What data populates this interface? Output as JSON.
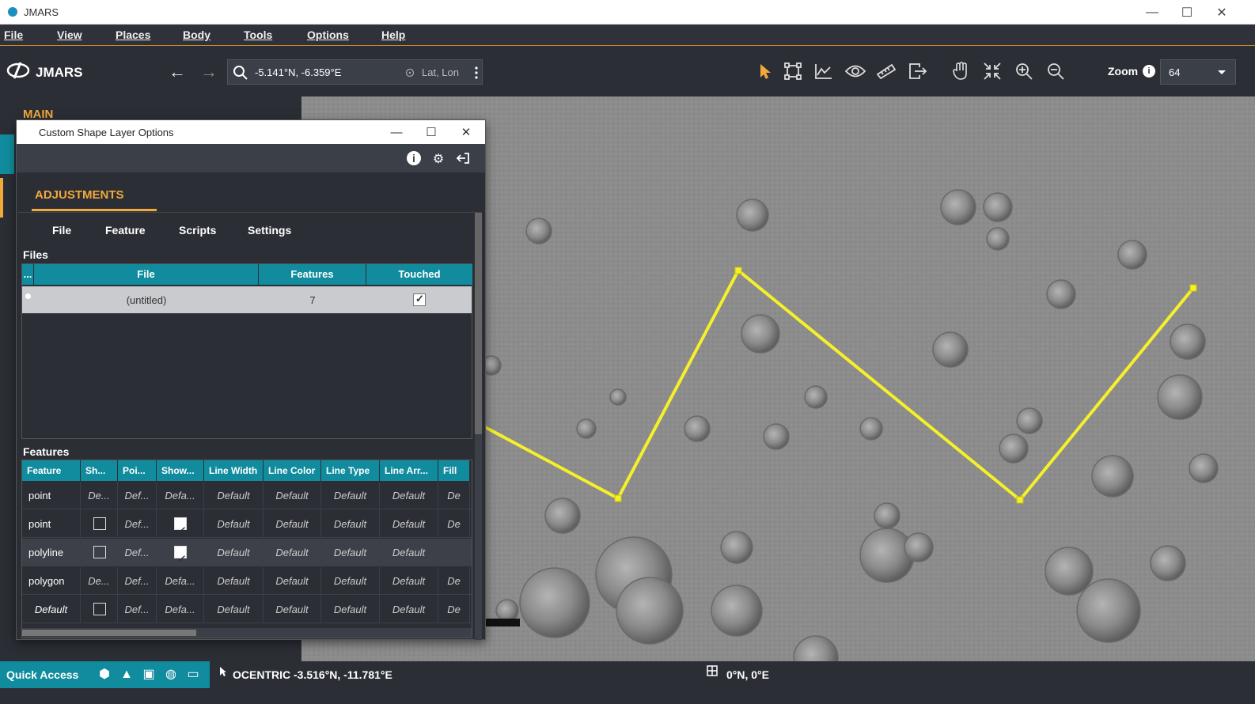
{
  "window": {
    "title": "JMARS",
    "minimize": "—",
    "maximize": "☐",
    "close": "✕"
  },
  "menu": [
    "File",
    "View",
    "Places",
    "Body",
    "Tools",
    "Options",
    "Help"
  ],
  "toolbar": {
    "logo_text": "JMARS",
    "back": "←",
    "forward": "→",
    "search_value": "-5.141°N, -6.359°E",
    "search_mode": "Lat, Lon",
    "zoom_label": "Zoom",
    "zoom_value": "64",
    "tools": [
      "select-icon",
      "bounding-box-icon",
      "chart-icon",
      "eye-icon",
      "ruler-icon",
      "export-icon",
      "hand-icon",
      "compress-icon",
      "zoom-in-icon",
      "zoom-out-icon"
    ]
  },
  "left_panel": {
    "main_tab": "MAIN"
  },
  "dialog": {
    "title": "Custom Shape Layer Options",
    "adjustments_tab": "ADJUSTMENTS",
    "subtabs": [
      "File",
      "Feature",
      "Scripts",
      "Settings"
    ],
    "files_label": "Files",
    "files_columns": [
      "...",
      "File",
      "Features",
      "Touched"
    ],
    "files_rows": [
      {
        "file": "(untitled)",
        "features": "7",
        "touched": true
      }
    ],
    "features_label": "Features",
    "features_columns": [
      "Feature",
      "Sh...",
      "Poi...",
      "Show...",
      "Line Width",
      "Line Color",
      "Line Type",
      "Line Arr...",
      "Fill"
    ],
    "features_rows": [
      {
        "feature": "point",
        "sh": "De...",
        "poi": "Def...",
        "show": "Defa...",
        "lw": "Default",
        "lc": "Default",
        "lt": "Default",
        "la": "Default",
        "fill": "De",
        "sh_check": null,
        "show_check": null
      },
      {
        "feature": "point",
        "sh": "",
        "poi": "Def...",
        "show": "",
        "lw": "Default",
        "lc": "Default",
        "lt": "Default",
        "la": "Default",
        "fill": "De",
        "sh_check": false,
        "show_check": true
      },
      {
        "feature": "polyline",
        "sh": "",
        "poi": "Def...",
        "show": "",
        "lw": "Default",
        "lc": "Default",
        "lt": "Default",
        "la": "Default",
        "fill": "",
        "sh_check": false,
        "show_check": true
      },
      {
        "feature": "polygon",
        "sh": "De...",
        "poi": "Def...",
        "show": "Defa...",
        "lw": "Default",
        "lc": "Default",
        "lt": "Default",
        "la": "Default",
        "fill": "De",
        "sh_check": null,
        "show_check": null
      },
      {
        "feature": "Default",
        "sh": "",
        "poi": "Def...",
        "show": "Defa...",
        "lw": "Default",
        "lc": "Default",
        "lt": "Default",
        "la": "Default",
        "fill": "De",
        "sh_check": false,
        "show_check": null
      }
    ]
  },
  "status": {
    "quick_access": "Quick Access",
    "ocentric": "OCENTRIC  -3.516°N, -11.781°E",
    "center": "0°N, 0°E"
  },
  "colors": {
    "accent": "#f2a93b",
    "teal": "#118c9e",
    "shape": "#f5f02a"
  }
}
